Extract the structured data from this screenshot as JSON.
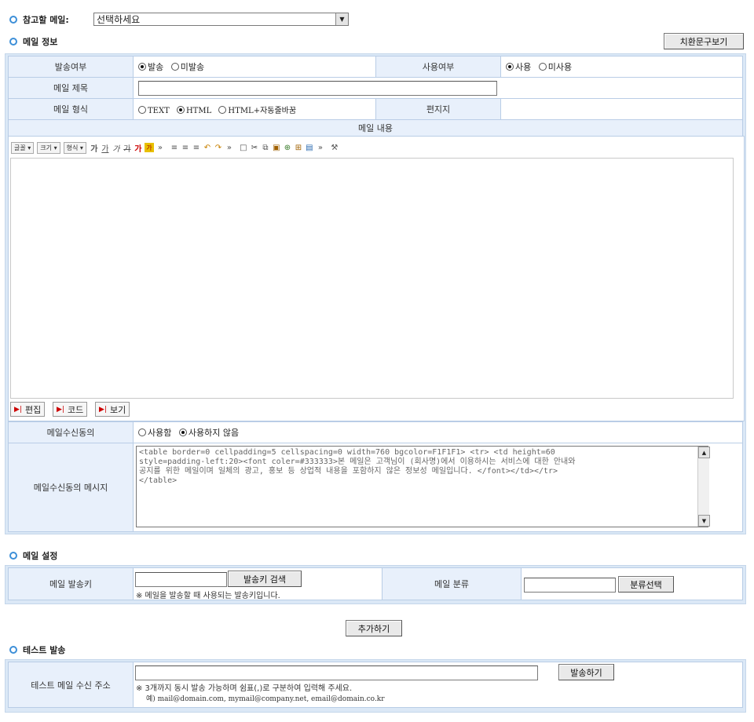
{
  "ref_mail": {
    "label": "참고할 메일:",
    "selected": "선택하세요"
  },
  "mail_info": {
    "title": "메일 정보",
    "replace_btn": "치환문구보기",
    "send_label": "발송여부",
    "send_opts": [
      "발송",
      "미발송"
    ],
    "use_label": "사용여부",
    "use_opts": [
      "사용",
      "미사용"
    ],
    "subject_label": "메일 제목",
    "subject_value": "",
    "format_label": "메일 형식",
    "format_opts": [
      "TEXT",
      "HTML",
      "HTML+자동줄바꿈"
    ],
    "stationery_label": "편지지",
    "content_label": "메일 내용",
    "editor": {
      "font_btn": "글꼴",
      "size_btn": "크기",
      "format_btn": "형식",
      "style_btns": [
        "가",
        "가",
        "가",
        "가",
        "가",
        "가"
      ],
      "mode_edit": "편집",
      "mode_code": "코드",
      "mode_view": "보기"
    },
    "consent_label": "메일수신동의",
    "consent_opts": [
      "사용함",
      "사용하지 않음"
    ],
    "consent_msg_label": "메일수신동의 메시지",
    "consent_msg": "<table border=0 cellpadding=5 cellspacing=0 width=760 bgcolor=F1F1F1> <tr> <td height=60\nstyle=padding-left:20><font coler=#333333>본 메일은 고객님이 (회사명)에서 이용하시는 서비스에 대한 안내와\n공지를 위한 메일이며 일체의 광고, 홍보 등 상업적 내용을 포함하지 않은 정보성 메일입니다. </font></td></tr>\n</table>"
  },
  "mail_setting": {
    "title": "메일 설정",
    "key_label": "메일 발송키",
    "key_value": "",
    "key_search_btn": "발송키 검색",
    "key_hint": "※ 메일을 발송할 때 사용되는 발송키입니다.",
    "category_label": "메일 분류",
    "category_value": "",
    "category_btn": "분류선택"
  },
  "add_btn": "추가하기",
  "test_send": {
    "title": "테스트 발송",
    "addr_label": "테스트 메일 수신 주소",
    "addr_value": "",
    "send_btn": "발송하기",
    "hint1": "※ 3개까지 동시 발송 가능하며 쉼표(,)로 구분하여 입력해 주세요.",
    "hint2": "예) mail@domain.com, mymail@company.net, email@domain.co.kr"
  },
  "colors": {
    "accent": "#3d8fd8",
    "label_bg": "#e8f0fb",
    "panel_bg": "#dbe8f6",
    "border": "#b9cde6"
  }
}
